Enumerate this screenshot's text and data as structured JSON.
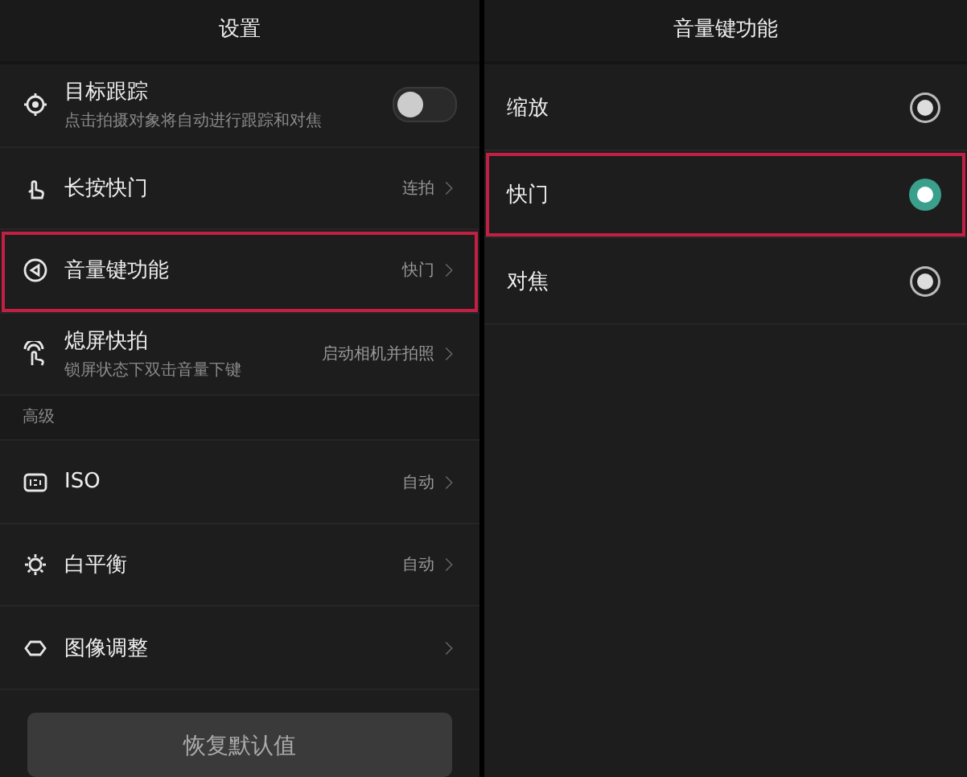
{
  "settings": {
    "title": "设置",
    "items": [
      {
        "kind": "switch",
        "label": "目标跟踪",
        "subtitle": "点击拍摄对象将自动进行跟踪和对焦",
        "on": false,
        "highlighted": false
      },
      {
        "kind": "value",
        "label": "长按快门",
        "value": "连拍",
        "highlighted": false
      },
      {
        "kind": "value",
        "label": "音量键功能",
        "value": "快门",
        "highlighted": true
      },
      {
        "kind": "value",
        "label": "熄屏快拍",
        "subtitle": "锁屏状态下双击音量下键",
        "value": "启动相机并拍照",
        "highlighted": false
      },
      {
        "kind": "header",
        "label": "高级"
      },
      {
        "kind": "value",
        "label": "ISO",
        "value": "自动",
        "highlighted": false
      },
      {
        "kind": "value",
        "label": "白平衡",
        "value": "自动",
        "highlighted": false
      },
      {
        "kind": "value",
        "label": "图像调整",
        "highlighted": false
      }
    ],
    "reset_button": "恢复默认值"
  },
  "volume_key": {
    "title": "音量键功能",
    "options": [
      {
        "label": "缩放",
        "selected": false,
        "highlighted": false
      },
      {
        "label": "快门",
        "selected": true,
        "highlighted": true
      },
      {
        "label": "对焦",
        "selected": false,
        "highlighted": false
      }
    ]
  }
}
